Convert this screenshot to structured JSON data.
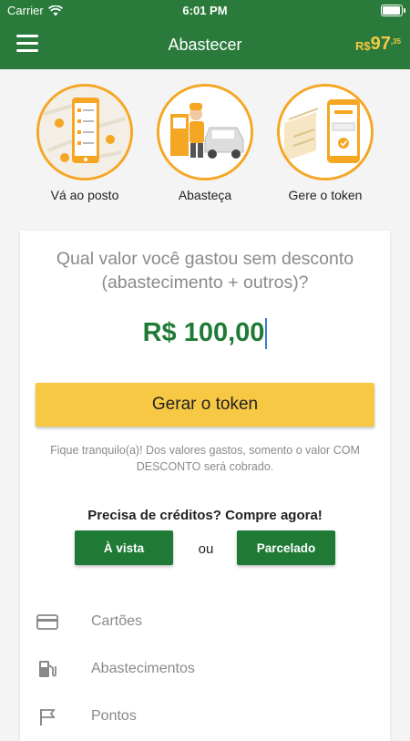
{
  "status_bar": {
    "carrier": "Carrier",
    "time": "6:01 PM"
  },
  "header": {
    "title": "Abastecer",
    "balance": {
      "currency": "R$",
      "integer": "97",
      "decimal": "35"
    }
  },
  "steps": [
    {
      "label": "Vá ao posto",
      "icon": "phone-map-icon"
    },
    {
      "label": "Abasteça",
      "icon": "fuel-station-icon"
    },
    {
      "label": "Gere o token",
      "icon": "phone-token-icon"
    }
  ],
  "token_card": {
    "question": "Qual valor você gastou sem desconto (abastecimento + outros)?",
    "amount": "R$ 100,00",
    "generate_button": "Gerar o token",
    "note": "Fique tranquilo(a)! Dos valores gastos, somento o valor COM DESCONTO será cobrado."
  },
  "buy_credits": {
    "title": "Precisa de créditos? Compre agora!",
    "cash_button": "À vista",
    "separator": "ou",
    "installments_button": "Parcelado"
  },
  "menu": [
    {
      "label": "Cartões",
      "icon": "credit-card-icon"
    },
    {
      "label": "Abastecimentos",
      "icon": "fuel-pump-icon"
    },
    {
      "label": "Pontos",
      "icon": "flag-icon"
    }
  ],
  "colors": {
    "primary_green": "#2a7a3b",
    "button_green": "#1f7a36",
    "accent_yellow": "#f6c844",
    "orange": "#f5a623"
  }
}
